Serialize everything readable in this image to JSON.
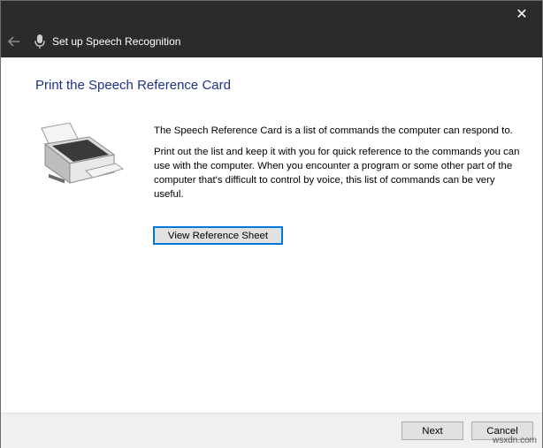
{
  "window": {
    "title": "Set up Speech Recognition",
    "close_glyph": "✕"
  },
  "page": {
    "heading": "Print the Speech Reference Card",
    "paragraph1": "The Speech Reference Card is a list of commands the computer can respond to.",
    "paragraph2": "Print out the list and keep it with you for quick reference to the commands you can use with the computer. When you encounter a program or some other part of the computer that's difficult to control by voice, this list of commands can be very useful.",
    "view_button": "View Reference Sheet"
  },
  "footer": {
    "next_label": "Next",
    "cancel_label": "Cancel"
  },
  "watermark": "wsxdn.com",
  "icons": {
    "back": "back-arrow-icon",
    "mic": "microphone-icon",
    "printer": "printer-icon",
    "close": "close-icon"
  },
  "colors": {
    "titlebar": "#2b2b2b",
    "heading": "#1e3287",
    "focus_border": "#0078d7",
    "footer_bg": "#f0f0f0"
  }
}
